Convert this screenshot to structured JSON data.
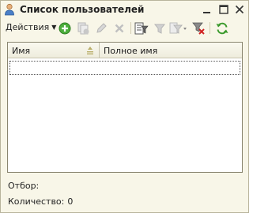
{
  "window": {
    "title": "Список пользователей",
    "icon": "user-icon",
    "controls": [
      "minimize-icon",
      "maximize-icon",
      "close-icon"
    ]
  },
  "toolbar": {
    "actions_label": "Действия",
    "buttons": [
      {
        "name": "add-icon",
        "enabled": true
      },
      {
        "name": "copy-icon",
        "enabled": false
      },
      {
        "name": "edit-icon",
        "enabled": false
      },
      {
        "name": "delete-icon",
        "enabled": false
      },
      {
        "name": "filter-settings-icon",
        "enabled": true
      },
      {
        "name": "filter-by-value-icon",
        "enabled": false
      },
      {
        "name": "filter-history-icon",
        "enabled": false
      },
      {
        "name": "clear-filter-icon",
        "enabled": true
      },
      {
        "name": "refresh-icon",
        "enabled": true
      }
    ]
  },
  "grid": {
    "columns": [
      {
        "label": "Имя",
        "sorted": "ascending"
      },
      {
        "label": "Полное имя"
      }
    ],
    "rows": []
  },
  "footer": {
    "filter_label": "Отбор:",
    "count_label": "Количество:",
    "count_value": "0"
  },
  "colors": {
    "window_bg": "#f8f6e8",
    "accent_green": "#3a9a2c",
    "disabled_gray": "#b8b8b8",
    "delete_red": "#c82020"
  }
}
